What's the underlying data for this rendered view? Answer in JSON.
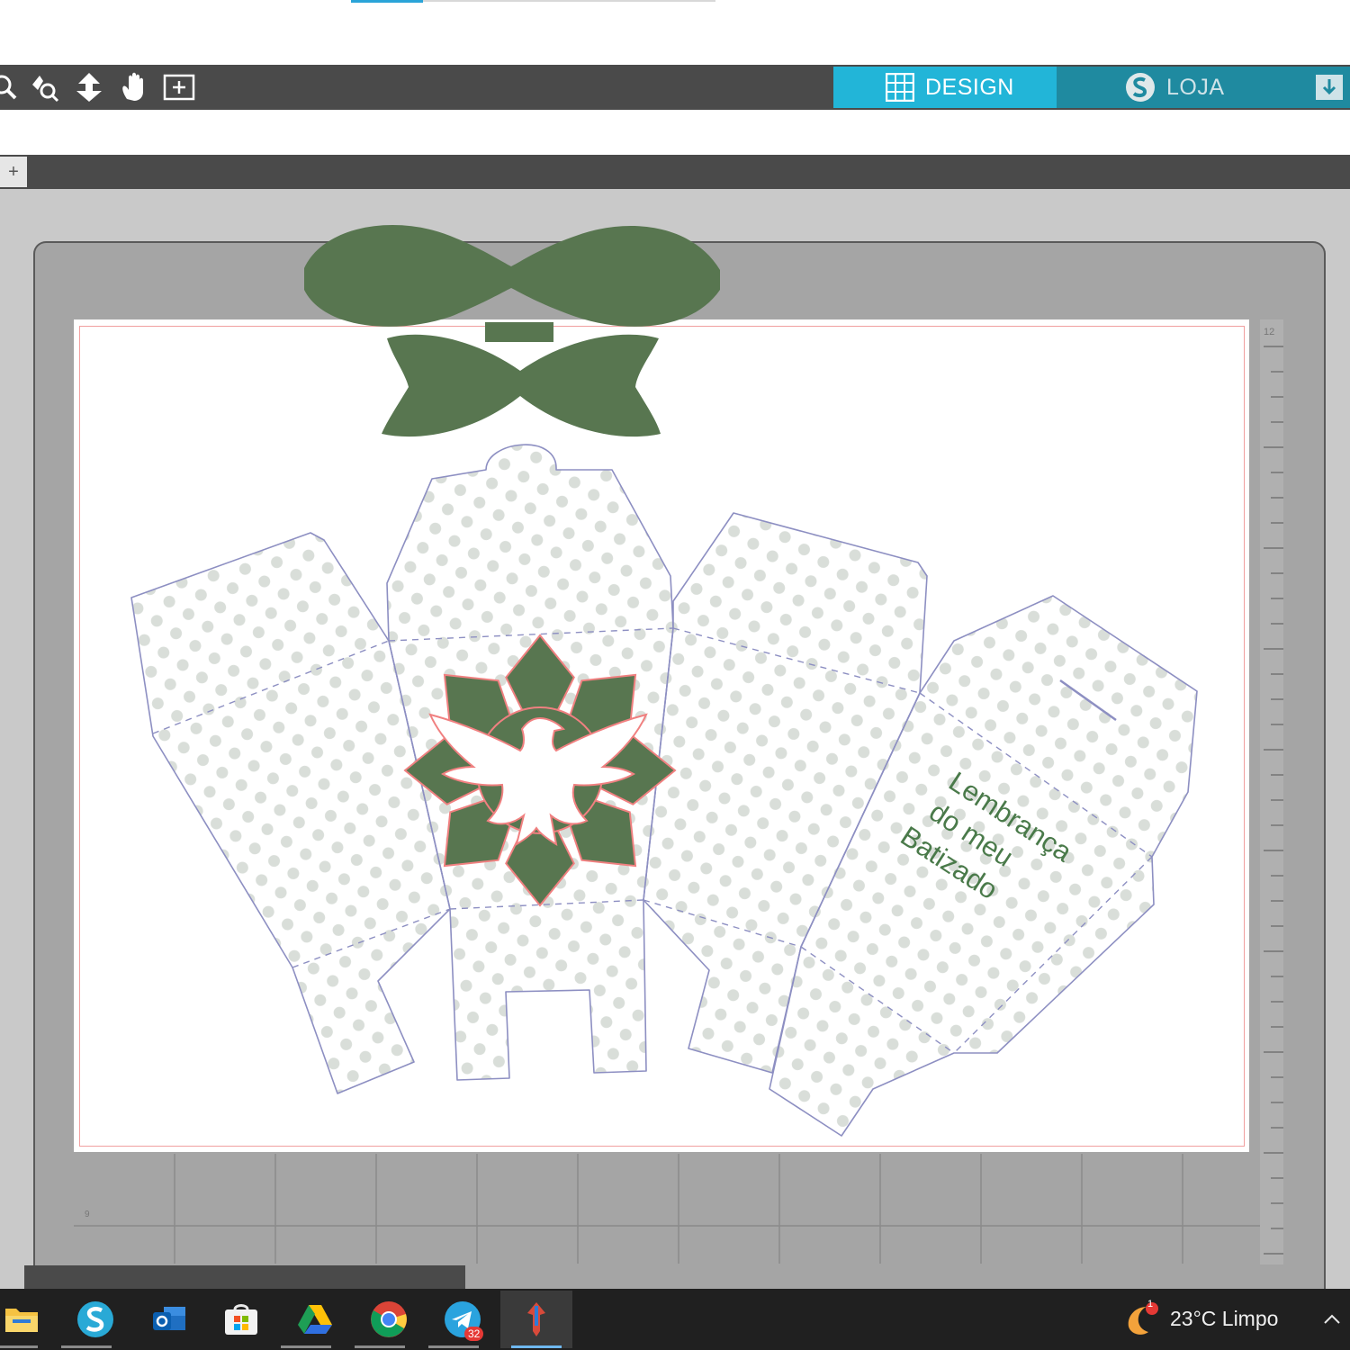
{
  "header": {
    "tabs": [
      {
        "label": "DESIGN",
        "icon": "grid-icon",
        "active": true
      },
      {
        "label": "LOJA",
        "icon": "silhouette-s-icon",
        "active": false
      }
    ],
    "accent_color": "#22b5d8"
  },
  "toolbar": {
    "tools": [
      "zoom-icon",
      "zoom-select-icon",
      "move-down-icon",
      "pan-hand-icon",
      "fit-page-icon"
    ]
  },
  "document_bar": {
    "add_label": "+"
  },
  "mat": {
    "ruler_label": "12",
    "grid_label": "9"
  },
  "design": {
    "text_lines": [
      "Lembrança",
      "do meu",
      "Batizado"
    ],
    "text_color": "#4a7a4a",
    "shape_color": "#587650",
    "dot_color": "#d9ded9"
  },
  "taskbar": {
    "apps": [
      {
        "name": "file-explorer",
        "icon": "folder-icon"
      },
      {
        "name": "silhouette-studio",
        "icon": "silhouette-s-icon"
      },
      {
        "name": "outlook",
        "icon": "outlook-icon"
      },
      {
        "name": "microsoft-store",
        "icon": "store-icon"
      },
      {
        "name": "google-drive",
        "icon": "drive-icon"
      },
      {
        "name": "chrome",
        "icon": "chrome-icon"
      },
      {
        "name": "telegram",
        "icon": "telegram-icon",
        "badge": "32"
      },
      {
        "name": "pinned-app",
        "icon": "pin-app-icon"
      }
    ],
    "weather": {
      "text": "23°C  Limpo",
      "badge": "1"
    }
  }
}
